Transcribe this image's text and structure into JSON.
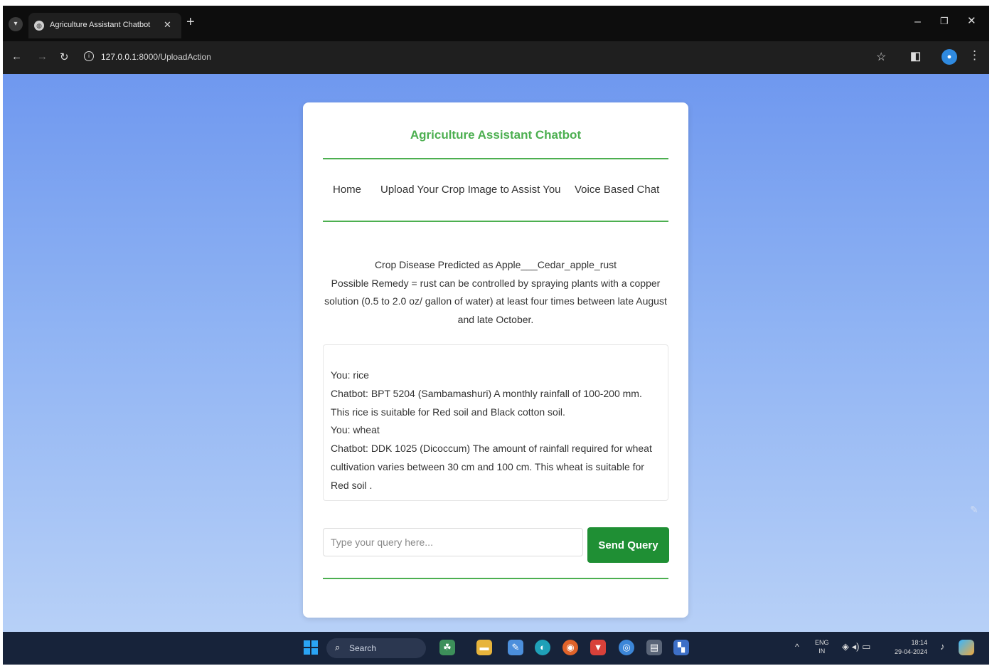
{
  "browser": {
    "tab_title": "Agriculture Assistant Chatbot",
    "tab_close": "✕",
    "new_tab": "+",
    "url_host": "127.0.0.1",
    "url_path": ":8000/UploadAction"
  },
  "page": {
    "title": "Agriculture Assistant Chatbot",
    "nav": {
      "home": "Home",
      "upload": "Upload Your Crop Image to Assist You",
      "voice": "Voice Based Chat"
    },
    "result": {
      "prediction": "Crop Disease Predicted as Apple___Cedar_apple_rust",
      "remedy": "Possible Remedy = rust can be controlled by spraying plants with a copper solution (0.5 to 2.0 oz/ gallon of water) at least four times between late August and late October."
    },
    "chat": {
      "messages": [
        "You: rice",
        "Chatbot: BPT 5204 (Sambamashuri) A monthly rainfall of 100-200 mm. This rice is suitable for Red soil and Black cotton soil.",
        "You: wheat",
        "Chatbot: DDK 1025 (Dicoccum) The amount of rainfall required for wheat cultivation varies between 30 cm and 100 cm. This wheat is suitable for Red soil ."
      ]
    },
    "query": {
      "placeholder": "Type your query here...",
      "value": "",
      "send_label": "Send Query"
    }
  },
  "taskbar": {
    "search_label": "Search",
    "lang": "ENG",
    "region": "IN",
    "time": "18:14",
    "date": "29-04-2024"
  },
  "colors": {
    "accent_green": "#4caf50",
    "button_green": "#1f8f34",
    "background_blue": "#8fb3f3"
  }
}
